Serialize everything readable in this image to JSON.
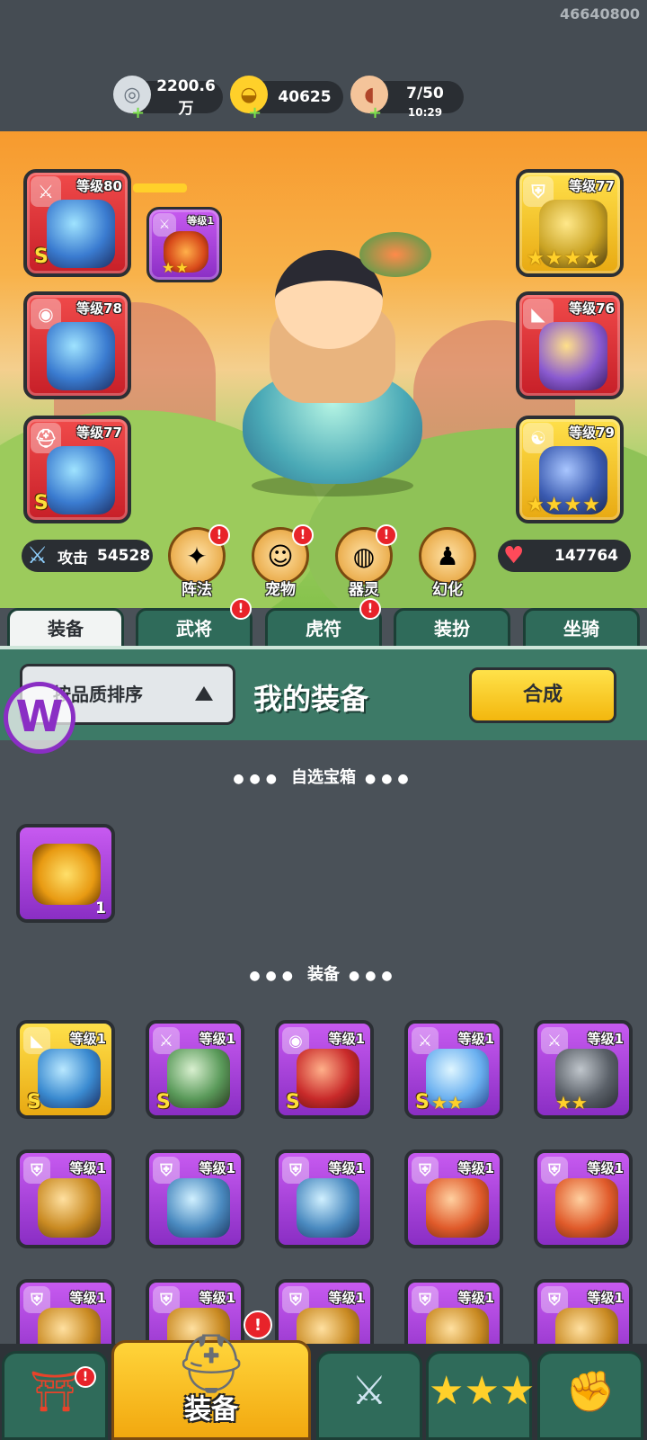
{
  "header": {
    "uid": "46640800",
    "resources": [
      {
        "icon": "silver-coin-icon",
        "value": "2200.6万"
      },
      {
        "icon": "gold-ingot-icon",
        "value": "40625"
      },
      {
        "icon": "meat-stamina-icon",
        "value": "7/50",
        "timer": "10:29"
      }
    ]
  },
  "hero_slots": {
    "left": [
      {
        "name": "weapon",
        "level": "等级80",
        "grade": "S",
        "icon": "sword-icon",
        "color": "#d32a30"
      },
      {
        "name": "medal",
        "level": "等级78",
        "grade": "",
        "icon": "medal-icon",
        "color": "#d32a30"
      },
      {
        "name": "helmet",
        "level": "等级77",
        "grade": "S",
        "icon": "helmet-icon",
        "color": "#d32a30"
      }
    ],
    "right": [
      {
        "name": "armor",
        "level": "等级77",
        "stars": "★★★★",
        "icon": "armor-icon",
        "color": "#f2c21e"
      },
      {
        "name": "bracer",
        "level": "等级76",
        "grade": "",
        "icon": "bracer-icon",
        "color": "#d32a30"
      },
      {
        "name": "boots",
        "level": "等级79",
        "stars": "★★★★",
        "icon": "yinyang-icon",
        "color": "#f2c21e"
      }
    ],
    "linked": {
      "level": "等级1",
      "stars": "★★"
    }
  },
  "stats": {
    "attack_label": "攻击",
    "attack_value": "54528",
    "hp_value": "147764"
  },
  "feature_buttons": [
    {
      "label": "阵法",
      "badge": "!"
    },
    {
      "label": "宠物",
      "badge": "!"
    },
    {
      "label": "器灵",
      "badge": "!"
    },
    {
      "label": "幻化",
      "badge": ""
    }
  ],
  "tabs": [
    {
      "label": "装备",
      "active": true,
      "badge": ""
    },
    {
      "label": "武将",
      "active": false,
      "badge": "!"
    },
    {
      "label": "虎符",
      "active": false,
      "badge": "!"
    },
    {
      "label": "装扮",
      "active": false,
      "badge": ""
    },
    {
      "label": "坐骑",
      "active": false,
      "badge": ""
    }
  ],
  "panel": {
    "sort_label": "按品质排序",
    "title": "我的装备",
    "combine_label": "合成"
  },
  "sections": {
    "chest_title": "自选宝箱",
    "chest_count": "1",
    "equip_title": "装备"
  },
  "equip_rows": [
    [
      {
        "level": "等级1",
        "grade": "S",
        "stars": "",
        "tag": "bracer-icon",
        "color": "gold"
      },
      {
        "level": "等级1",
        "grade": "S",
        "stars": "",
        "tag": "sword-icon",
        "color": "purple"
      },
      {
        "level": "等级1",
        "grade": "S",
        "stars": "",
        "tag": "medal-icon",
        "color": "purple"
      },
      {
        "level": "等级1",
        "grade": "S",
        "stars": "★★",
        "tag": "sword-icon",
        "color": "purple"
      },
      {
        "level": "等级1",
        "grade": "",
        "stars": "★★",
        "tag": "sword-icon",
        "color": "purple"
      }
    ],
    [
      {
        "level": "等级1",
        "grade": "",
        "stars": "",
        "tag": "armor-icon",
        "color": "purple"
      },
      {
        "level": "等级1",
        "grade": "",
        "stars": "",
        "tag": "armor-icon",
        "color": "purple"
      },
      {
        "level": "等级1",
        "grade": "",
        "stars": "",
        "tag": "armor-icon",
        "color": "purple"
      },
      {
        "level": "等级1",
        "grade": "",
        "stars": "",
        "tag": "armor-icon",
        "color": "purple"
      },
      {
        "level": "等级1",
        "grade": "",
        "stars": "",
        "tag": "armor-icon",
        "color": "purple"
      }
    ],
    [
      {
        "level": "等级1",
        "grade": "",
        "stars": "",
        "tag": "armor-icon",
        "color": "purple"
      },
      {
        "level": "等级1",
        "grade": "",
        "stars": "",
        "tag": "armor-icon",
        "color": "purple"
      },
      {
        "level": "等级1",
        "grade": "",
        "stars": "",
        "tag": "armor-icon",
        "color": "purple"
      },
      {
        "level": "等级1",
        "grade": "",
        "stars": "",
        "tag": "armor-icon",
        "color": "purple"
      },
      {
        "level": "等级1",
        "grade": "",
        "stars": "",
        "tag": "armor-icon",
        "color": "purple"
      }
    ]
  ],
  "bottom_nav": [
    {
      "label": "",
      "icon": "shop-gate-icon",
      "badge": "!"
    },
    {
      "label": "装备",
      "icon": "helmet-icon",
      "badge": "!",
      "active": true
    },
    {
      "label": "",
      "icon": "battle-shield-icon",
      "badge": ""
    },
    {
      "label": "",
      "icon": "chicken-leg-icon",
      "badge": ""
    },
    {
      "label": "",
      "icon": "fist-upgrade-icon",
      "badge": ""
    }
  ]
}
